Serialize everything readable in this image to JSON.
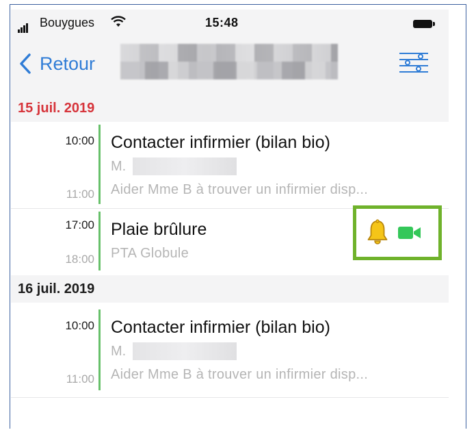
{
  "status_bar": {
    "carrier": "Bouygues",
    "time": "15:48",
    "icons": [
      "signal-icon",
      "wifi-icon",
      "battery-icon"
    ]
  },
  "nav": {
    "back_label": "Retour",
    "filter_icon": "sliders-icon"
  },
  "sections": [
    {
      "date": "15 juil. 2019",
      "color": "#d6333a",
      "events": [
        {
          "start": "10:00",
          "end": "11:00",
          "title": "Contacter infirmier (bilan bio)",
          "subtitle": "M.",
          "description": "Aider Mme B à trouver un infirmier disp..."
        },
        {
          "start": "17:00",
          "end": "18:00",
          "title": "Plaie brûlure",
          "subtitle": "PTA Globule",
          "icons": [
            "bell-icon",
            "video-camera-icon"
          ]
        }
      ]
    },
    {
      "date": "16 juil. 2019",
      "color": "#1b1b1b",
      "events": [
        {
          "start": "10:00",
          "end": "11:00",
          "title": "Contacter infirmier (bilan bio)",
          "subtitle": "M.",
          "description": "Aider Mme B à trouver un infirmier disp..."
        }
      ]
    }
  ],
  "colors": {
    "accent_blue": "#2f7cd6",
    "timeline_green": "#67c06a",
    "highlight_green": "#6fb22b",
    "bell_yellow": "#f5c518",
    "video_green": "#34c759"
  }
}
